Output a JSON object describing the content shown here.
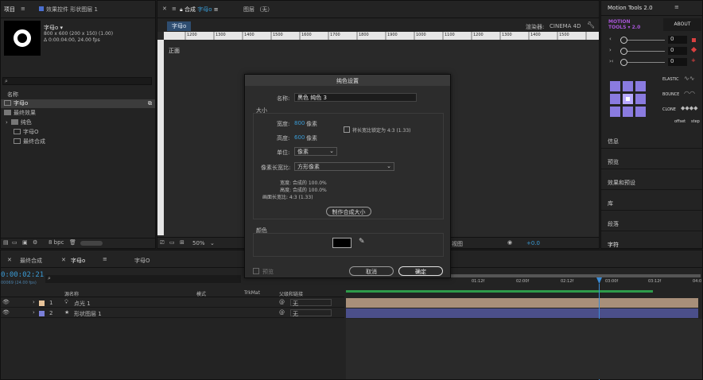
{
  "project_panel": {
    "tab_project": "项目",
    "tab_effects": "效果控件 形状图层 1",
    "comp_name": "字母o ▾",
    "comp_info_1": "800 x 600 (200 x 150) (1.00)",
    "comp_info_2": "Δ 0:00:04:00, 24.00 fps",
    "search_placeholder": "",
    "col_name": "名称",
    "items": [
      {
        "label": "字母o",
        "indent": 0,
        "selected": true,
        "kind": "comp"
      },
      {
        "label": "最终效果",
        "indent": 0,
        "selected": false,
        "kind": "folder"
      },
      {
        "label": "纯色",
        "indent": 1,
        "selected": false,
        "kind": "folder"
      },
      {
        "label": "字母O",
        "indent": 1,
        "selected": false,
        "kind": "comp"
      },
      {
        "label": "最终合成",
        "indent": 1,
        "selected": false,
        "kind": "comp"
      }
    ],
    "bpc": "8 bpc"
  },
  "comp_panel": {
    "tab_label": "合成",
    "tab_comp": "字母o",
    "tab_layer": "图层 （无）",
    "view_tab": "字母o",
    "renderer_label": "渲染器:",
    "renderer_value": "CINEMA 4D",
    "view_label": "正面",
    "ruler_marks": [
      "1200",
      "1300",
      "1400",
      "1500",
      "1600",
      "1700",
      "1800",
      "1900",
      "1000",
      "1100",
      "1200",
      "1300",
      "1400",
      "1500",
      "1600",
      "1700",
      "1800",
      "1900"
    ],
    "zoom": "50%",
    "view_menu": "视图",
    "exposure": "+0.0"
  },
  "dialog": {
    "title": "纯色设置",
    "name_label": "名称:",
    "name_value": "黑色 纯色 3",
    "size_section": "大小",
    "width_label": "宽度:",
    "width_value": "800",
    "height_label": "高度:",
    "height_value": "600",
    "pixel_unit": "像素",
    "lock_label": "将长宽比锁定为 4:3 (1.33)",
    "units_label": "单位:",
    "units_value": "像素",
    "par_label": "像素长宽比:",
    "par_value": "方形像素",
    "info_width": "宽度: 合成的 100.0%",
    "info_height": "高度: 合成的 100.0%",
    "info_frame": "画面长宽比: 4:3 (1.33)",
    "make_comp_size": "制作合成大小",
    "color_section": "颜色",
    "swatch_color": "#000000",
    "preview_label": "预览",
    "cancel": "取消",
    "ok": "确定"
  },
  "motion_tools": {
    "title": "Motion Tools 2.0",
    "logo_line1": "MOTION",
    "logo_line2": "TOOLS ▾ 2.0",
    "about": "ABOUT",
    "fields": [
      "0",
      "0",
      "0"
    ],
    "elastic": "ELASTIC",
    "bounce": "BOUNCE",
    "clone": "CLONE",
    "offset": "offset",
    "step": "step",
    "accent": "#a855d8",
    "side_items": [
      "信息",
      "预览",
      "效果和预设",
      "库",
      "段落",
      "字符"
    ]
  },
  "timeline": {
    "tab_final": "最终合成",
    "tab_comp": "字母o",
    "tab_comp2": "字母O",
    "timecode": "0:00:02:21",
    "frame_info": "00069 (24.00 fps)",
    "col_source": "源名称",
    "col_mode": "模式",
    "col_trkmat": "TrkMat",
    "col_parent": "父级和链接",
    "ruler_labels": [
      "01:12f",
      "02:00f",
      "02:12f",
      "03:00f",
      "03:12f",
      "04:0"
    ],
    "layers": [
      {
        "num": "1",
        "name": "点光 1",
        "color": "#e8c49a",
        "parent": "无"
      },
      {
        "num": "2",
        "name": "形状图层 1",
        "color": "#7a7fd8",
        "parent": "无"
      }
    ]
  }
}
